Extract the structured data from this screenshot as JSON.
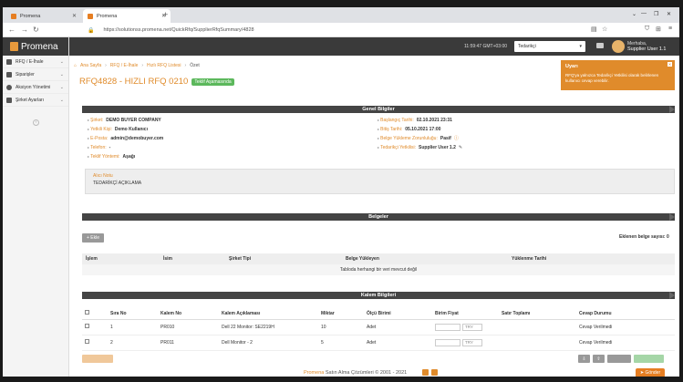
{
  "browser": {
    "tabs": [
      {
        "label": "Promena"
      },
      {
        "label": "Promena"
      }
    ],
    "url": "https://solutionss.promena.net/QuickRfq/SupplierRfqSummary/4828"
  },
  "app": {
    "logo": "Promena",
    "sidebar": [
      {
        "label": "RFQ / E-İhale"
      },
      {
        "label": "Siparişler"
      },
      {
        "label": "Aksiyon Yönetimi"
      },
      {
        "label": "Şirket Ayarları"
      }
    ],
    "topbar": {
      "clock": "11:59:47 GMT+03:00",
      "role": "Tedarikçi",
      "user_greeting": "Merhaba,",
      "user_name": "Supplier User 1.1"
    },
    "breadcrumb": [
      "Ana Sayfa",
      "RFQ / E-İhale",
      "Hızlı RFQ Listesi",
      "Özet"
    ],
    "title": "RFQ4828 - HIZLI RFQ 0210",
    "status_badge": "Teklif Aşamasında",
    "general": {
      "section_title": "Genel Bilgiler",
      "left": [
        {
          "label": "Şirket:",
          "value": "DEMO BUYER COMPANY"
        },
        {
          "label": "Yetkili Kişi:",
          "value": "Demo Kullanıcı"
        },
        {
          "label": "E-Posta:",
          "value": "admin@demobuyer.com"
        },
        {
          "label": "Telefon:",
          "value": "-"
        },
        {
          "label": "Teklif Yöntemi:",
          "value": "Aşağı"
        }
      ],
      "right": [
        {
          "label": "Başlangıç Tarihi:",
          "value": "02.10.2021 23:31"
        },
        {
          "label": "Bitiş Tarihi:",
          "value": "05.10.2021 17:00"
        },
        {
          "label": "Belge Yükleme Zorunluluğu:",
          "value": "Pasif"
        },
        {
          "label": "Tedarikçi Yetkilisi:",
          "value": "Supplier User 1.2"
        }
      ],
      "note_title": "Alıcı Notu",
      "note_value": "TEDARİKÇİ AÇIKLAMA"
    },
    "documents": {
      "section_title": "Belgeler",
      "add_button": "Ekle",
      "count_label": "Eklenen belge sayısı: 0",
      "columns": [
        "İşlem",
        "İsim",
        "Şirket Tipi",
        "Belge Yükleyen",
        "Yüklenme Tarihi"
      ],
      "empty_text": "Tabloda herhangi bir veri mevcut değil"
    },
    "items": {
      "section_title": "Kalem Bilgileri",
      "columns": [
        "",
        "Sıra No",
        "Kalem No",
        "Kalem Açıklaması",
        "Miktar",
        "Ölçü Birimi",
        "Birim Fiyat",
        "Satır Toplamı",
        "Cevap Durumu"
      ],
      "rows": [
        {
          "sira": "1",
          "kalem_no": "PR010",
          "aciklama": "Dell 22 Monitor: SE2219H",
          "miktar": "10",
          "birim": "Adet",
          "currency": "TRY",
          "durum": "Cevap Verilmedi"
        },
        {
          "sira": "2",
          "kalem_no": "PR011",
          "aciklama": "Dell Monitor - 2",
          "miktar": "5",
          "birim": "Adet",
          "currency": "TRY",
          "durum": "Cevap Verilmedi"
        }
      ]
    },
    "footer": {
      "brand": "Promena",
      "text": "Satın Alma Çözümleri © 2001 - 2021"
    },
    "send_button": "Gönder",
    "toast": {
      "title": "Uyarı",
      "message": "RFQ'ya yalnızca Tedarikçi Yetkilisi olarak belirlenen kullanıcı cevap verebilir."
    }
  },
  "colors": {
    "accent": "#e08b2b",
    "dark": "#3a3a3a",
    "badge": "#5cb85c"
  }
}
